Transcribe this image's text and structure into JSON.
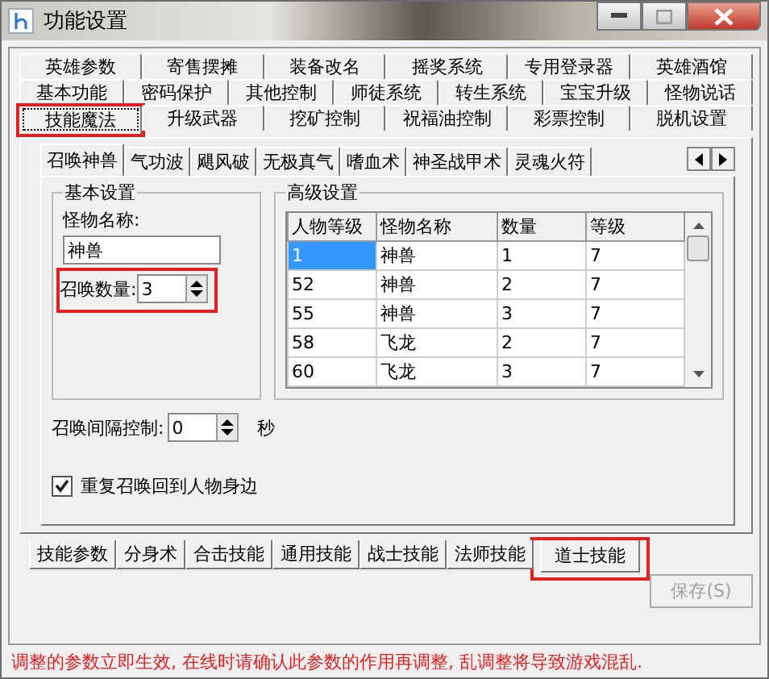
{
  "window": {
    "title": "功能设置"
  },
  "main_tab_rows": [
    {
      "tabs": [
        {
          "label": "英雄参数",
          "selected": false,
          "highlighted": false
        },
        {
          "label": "寄售摆摊",
          "selected": false,
          "highlighted": false
        },
        {
          "label": "装备改名",
          "selected": false,
          "highlighted": false
        },
        {
          "label": "摇奖系统",
          "selected": false,
          "highlighted": false
        },
        {
          "label": "专用登录器",
          "selected": false,
          "highlighted": false
        },
        {
          "label": "英雄酒馆",
          "selected": false,
          "highlighted": false
        }
      ]
    },
    {
      "tabs": [
        {
          "label": "基本功能",
          "selected": false,
          "highlighted": false
        },
        {
          "label": "密码保护",
          "selected": false,
          "highlighted": false
        },
        {
          "label": "其他控制",
          "selected": false,
          "highlighted": false
        },
        {
          "label": "师徒系统",
          "selected": false,
          "highlighted": false
        },
        {
          "label": "转生系统",
          "selected": false,
          "highlighted": false
        },
        {
          "label": "宝宝升级",
          "selected": false,
          "highlighted": false
        },
        {
          "label": "怪物说话",
          "selected": false,
          "highlighted": false
        }
      ]
    },
    {
      "tabs": [
        {
          "label": "技能魔法",
          "selected": true,
          "highlighted": true
        },
        {
          "label": "升级武器",
          "selected": false,
          "highlighted": false
        },
        {
          "label": "挖矿控制",
          "selected": false,
          "highlighted": false
        },
        {
          "label": "祝福油控制",
          "selected": false,
          "highlighted": false
        },
        {
          "label": "彩票控制",
          "selected": false,
          "highlighted": false
        },
        {
          "label": "脱机设置",
          "selected": false,
          "highlighted": false
        }
      ]
    }
  ],
  "skill_tabs": [
    {
      "label": "召唤神兽",
      "selected": true
    },
    {
      "label": "气功波",
      "selected": false
    },
    {
      "label": "飓风破",
      "selected": false
    },
    {
      "label": "无极真气",
      "selected": false
    },
    {
      "label": "嗜血术",
      "selected": false
    },
    {
      "label": "神圣战甲术",
      "selected": false
    },
    {
      "label": "灵魂火符",
      "selected": false
    }
  ],
  "basic_settings": {
    "title": "基本设置",
    "monster_name_label": "怪物名称:",
    "monster_name_value": "神兽",
    "summon_count_label": "召唤数量:",
    "summon_count_value": "3",
    "summon_count_highlighted": true
  },
  "advanced_settings": {
    "title": "高级设置",
    "table": {
      "columns": [
        "人物等级",
        "怪物名称",
        "数量",
        "等级"
      ],
      "rows": [
        {
          "cells": [
            "1",
            "神兽",
            "1",
            "7"
          ],
          "selected": true
        },
        {
          "cells": [
            "52",
            "神兽",
            "2",
            "7"
          ],
          "selected": false
        },
        {
          "cells": [
            "55",
            "神兽",
            "3",
            "7"
          ],
          "selected": false
        },
        {
          "cells": [
            "58",
            "飞龙",
            "2",
            "7"
          ],
          "selected": false
        },
        {
          "cells": [
            "60",
            "飞龙",
            "3",
            "7"
          ],
          "selected": false
        }
      ]
    }
  },
  "interval": {
    "label": "召唤间隔控制:",
    "value": "0",
    "unit": "秒"
  },
  "repeat_checkbox": {
    "label": "重复召唤回到人物身边",
    "checked": true
  },
  "category_tabs": [
    {
      "label": "技能参数",
      "selected": false,
      "highlighted": false
    },
    {
      "label": "分身术",
      "selected": false,
      "highlighted": false
    },
    {
      "label": "合击技能",
      "selected": false,
      "highlighted": false
    },
    {
      "label": "通用技能",
      "selected": false,
      "highlighted": false
    },
    {
      "label": "战士技能",
      "selected": false,
      "highlighted": false
    },
    {
      "label": "法师技能",
      "selected": false,
      "highlighted": false
    },
    {
      "label": "道士技能",
      "selected": true,
      "highlighted": true
    }
  ],
  "save_button": {
    "label": "保存(S)",
    "disabled": true
  },
  "footer_note": "调整的参数立即生效, 在线时请确认此参数的作用再调整, 乱调整将导致游戏混乱."
}
